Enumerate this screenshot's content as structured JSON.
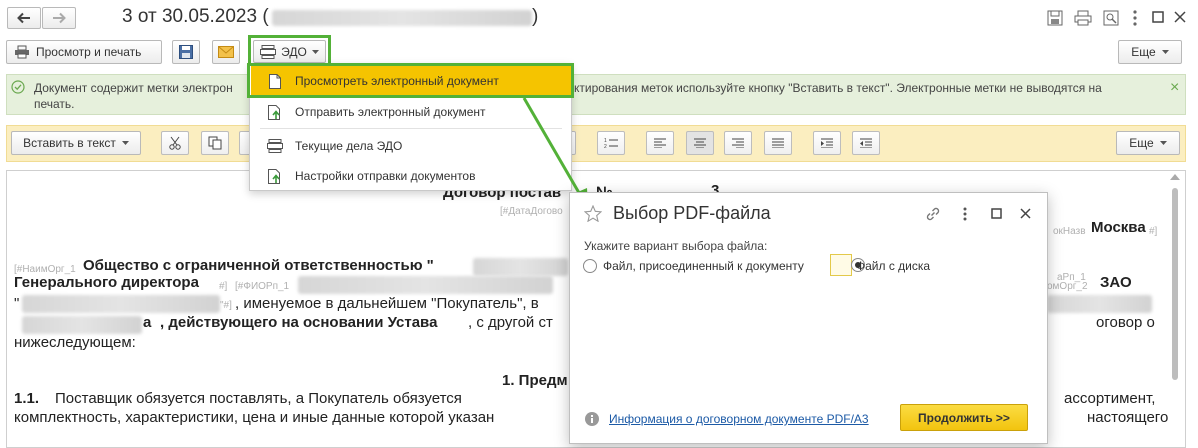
{
  "window": {
    "title": "3 от 30.05.2023 (",
    "title_suffix": ")"
  },
  "toolbar": {
    "preview_print": "Просмотр и печать",
    "edo": "ЭДО",
    "more": "Еще"
  },
  "edo_menu": {
    "items": [
      "Просмотреть электронный документ",
      "Отправить электронный документ",
      "Текущие дела ЭДО",
      "Настройки отправки документов"
    ]
  },
  "info_bar": {
    "line1_a": "Документ содержит метки электрон",
    "line1_b": "ктирования меток используйте кнопку \"Вставить в текст\". Электронные метки не выводятся на",
    "line2": "печать.",
    "close": "×"
  },
  "format_bar": {
    "insert_text": "Вставить в текст",
    "more": "Еще"
  },
  "document": {
    "title": "Договор постав",
    "title_no": "№",
    "title_num": "3",
    "ph_date": "[#ДатаДогово",
    "ph_doc_name": "окНазв",
    "city": "Москва",
    "ph_city_end": "#]",
    "ph_org1": "[#НаимОрг_1",
    "org1_text": "Общество с ограниченной ответственностью \"",
    "ph_rp1": "аРп_1",
    "director": "Генерального директора",
    "ph_fio_end": "#]",
    "ph_fio": "[#ФИОРп_1",
    "ph_org2": "омОрг_2",
    "zao": "ЗАО",
    "quote": "\"",
    "ph_hash_end": "\"#]",
    "buyer_text": ", именуемое в дальнейшем \"Покупатель\", в",
    "line4_a": "а",
    "line4_b": ", действующего на основании Устава",
    "line4_c": ", с другой ст",
    "line4_end": "оговор о",
    "line5": "нижеследующем:",
    "section": "1. Предм",
    "clause_num": "1.1.",
    "clause_text": "Поставщик обязуется поставлять, а Покупатель обязуется",
    "clause_end": "ассортимент,",
    "line8": "комплектность, характеристики, цена и иные данные которой указан",
    "line8_end": "настоящего"
  },
  "dialog": {
    "title": "Выбор PDF-файла",
    "prompt": "Укажите вариант выбора файла:",
    "option1": "Файл, присоединенный к документу",
    "option2": "Файл с диска",
    "selected": "option2",
    "info_link": "Информация о договорном документе PDF/A3",
    "continue": "Продолжить >>"
  },
  "colors": {
    "highlight_green": "#53b138",
    "menu_selected": "#f5c400",
    "info_bar_bg": "#e6f0dc",
    "format_bar_bg": "#fbeec0",
    "continue_bg": "#f8d11f"
  }
}
